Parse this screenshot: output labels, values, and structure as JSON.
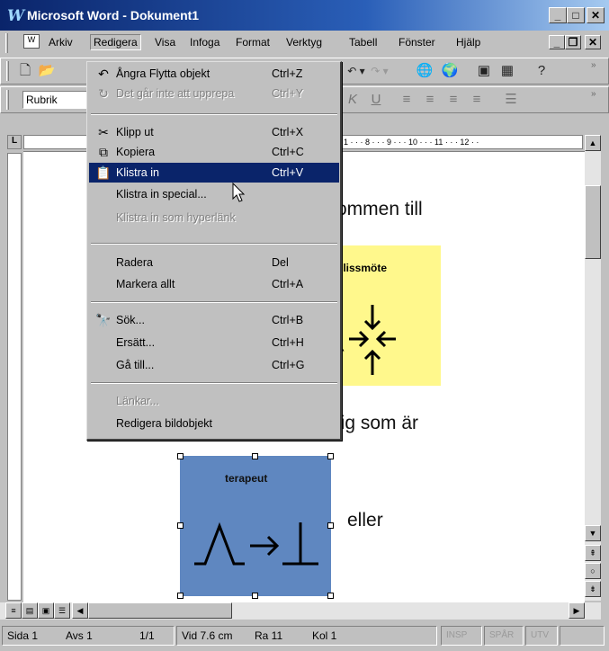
{
  "window": {
    "title": "Microsoft Word - Dokument1",
    "logo_letter": "W"
  },
  "menubar": [
    "Arkiv",
    "Redigera",
    "Visa",
    "Infoga",
    "Format",
    "Verktyg",
    "Tabell",
    "Fönster",
    "Hjälp"
  ],
  "toolbar2": {
    "style_value": "Rubrik"
  },
  "edit_menu": {
    "items": [
      {
        "label": "Ångra Flytta objekt",
        "shortcut": "Ctrl+Z",
        "icon": "undo-icon",
        "glyph": "↶",
        "disabled": false
      },
      {
        "label": "Det går inte att upprepa",
        "shortcut": "Ctrl+Y",
        "icon": "redo-icon",
        "glyph": "↻",
        "disabled": true
      },
      {
        "label": "Klipp ut",
        "shortcut": "Ctrl+X",
        "icon": "scissors-icon",
        "glyph": "✂",
        "disabled": false
      },
      {
        "label": "Kopiera",
        "shortcut": "Ctrl+C",
        "icon": "copy-icon",
        "glyph": "⧉",
        "disabled": false
      },
      {
        "label": "Klistra in",
        "shortcut": "Ctrl+V",
        "icon": "paste-icon",
        "glyph": "📋",
        "disabled": false,
        "selected": true
      },
      {
        "label": "Klistra in special...",
        "shortcut": "",
        "disabled": false
      },
      {
        "label": "Klistra in som hyperlänk",
        "shortcut": "",
        "disabled": true
      },
      {
        "label": "Radera",
        "shortcut": "Del",
        "disabled": false
      },
      {
        "label": "Markera allt",
        "shortcut": "Ctrl+A",
        "disabled": false
      },
      {
        "label": "Sök...",
        "shortcut": "Ctrl+B",
        "icon": "binoculars-icon",
        "glyph": "🔭",
        "disabled": false
      },
      {
        "label": "Ersätt...",
        "shortcut": "Ctrl+H",
        "disabled": false
      },
      {
        "label": "Gå till...",
        "shortcut": "Ctrl+G",
        "disabled": false
      },
      {
        "label": "Länkar...",
        "shortcut": "",
        "disabled": true
      },
      {
        "label": "Redigera bildobjekt",
        "shortcut": "",
        "disabled": false
      }
    ]
  },
  "ruler_text": "1 · · · 8 · · · 9 · · · 10 · · · 11 · · · 12 · ·",
  "document": {
    "line1": "ommen till",
    "yellow_box_title": "plissmöte",
    "line2": "lig som är",
    "blue_box_title": "terapeut",
    "line3": "eller"
  },
  "status": {
    "sida": "Sida 1",
    "avs": "Avs 1",
    "pages": "1/1",
    "vid": "Vid 7.6 cm",
    "ra": "Ra 11",
    "kol": "Kol 1",
    "insp": "INSP",
    "spar": "SPÅR",
    "utv": "UTV"
  }
}
